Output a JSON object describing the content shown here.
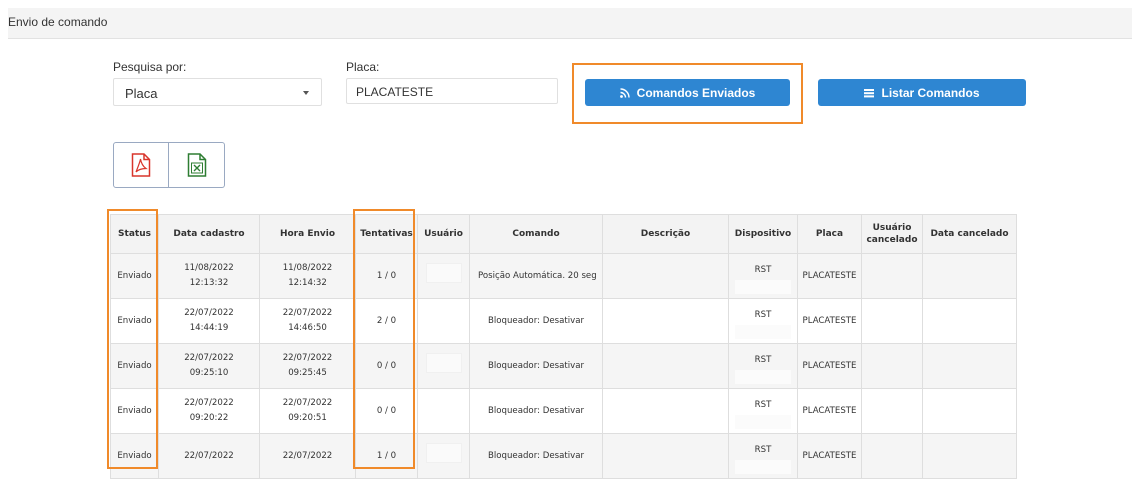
{
  "header": {
    "title": "Envio de comando"
  },
  "filters": {
    "search_by_label": "Pesquisa por:",
    "search_by_value": "Placa",
    "plate_label": "Placa:",
    "plate_value": "PLACATESTE"
  },
  "buttons": {
    "sent_commands": "Comandos Enviados",
    "list_commands": "Listar Comandos"
  },
  "icons": {
    "sent_commands": "rss-icon",
    "list_commands": "list-icon",
    "export_pdf": "pdf-file-icon",
    "export_excel": "excel-file-icon"
  },
  "colors": {
    "primary": "#2e86d2",
    "highlight": "#f08a2a",
    "pdf": "#d9352b",
    "excel": "#2e7d32"
  },
  "table": {
    "headers": {
      "status": "Status",
      "data_cadastro": "Data cadastro",
      "hora_envio": "Hora Envio",
      "tentativas": "Tentativas",
      "usuario": "Usuário",
      "comando": "Comando",
      "descricao": "Descrição",
      "dispositivo": "Dispositivo",
      "placa": "Placa",
      "usuario_cancelado_1": "Usuário",
      "usuario_cancelado_2": "cancelado",
      "data_cancelado": "Data cancelado"
    },
    "rows": [
      {
        "status": "Enviado",
        "cad_date": "11/08/2022",
        "cad_time": "12:13:32",
        "env_date": "11/08/2022",
        "env_time": "12:14:32",
        "tentativas": "1 / 0",
        "comando": "Posição Automática. 20 seg",
        "dispositivo": "RST",
        "placa": "PLACATESTE"
      },
      {
        "status": "Enviado",
        "cad_date": "22/07/2022",
        "cad_time": "14:44:19",
        "env_date": "22/07/2022",
        "env_time": "14:46:50",
        "tentativas": "2 / 0",
        "comando": "Bloqueador: Desativar",
        "dispositivo": "RST",
        "placa": "PLACATESTE"
      },
      {
        "status": "Enviado",
        "cad_date": "22/07/2022",
        "cad_time": "09:25:10",
        "env_date": "22/07/2022",
        "env_time": "09:25:45",
        "tentativas": "0 / 0",
        "comando": "Bloqueador: Desativar",
        "dispositivo": "RST",
        "placa": "PLACATESTE"
      },
      {
        "status": "Enviado",
        "cad_date": "22/07/2022",
        "cad_time": "09:20:22",
        "env_date": "22/07/2022",
        "env_time": "09:20:51",
        "tentativas": "0 / 0",
        "comando": "Bloqueador: Desativar",
        "dispositivo": "RST",
        "placa": "PLACATESTE"
      },
      {
        "status": "Enviado",
        "cad_date": "22/07/2022",
        "cad_time": "",
        "env_date": "22/07/2022",
        "env_time": "",
        "tentativas": "1 / 0",
        "comando": "Bloqueador: Desativar",
        "dispositivo": "RST",
        "placa": "PLACATESTE"
      }
    ]
  }
}
